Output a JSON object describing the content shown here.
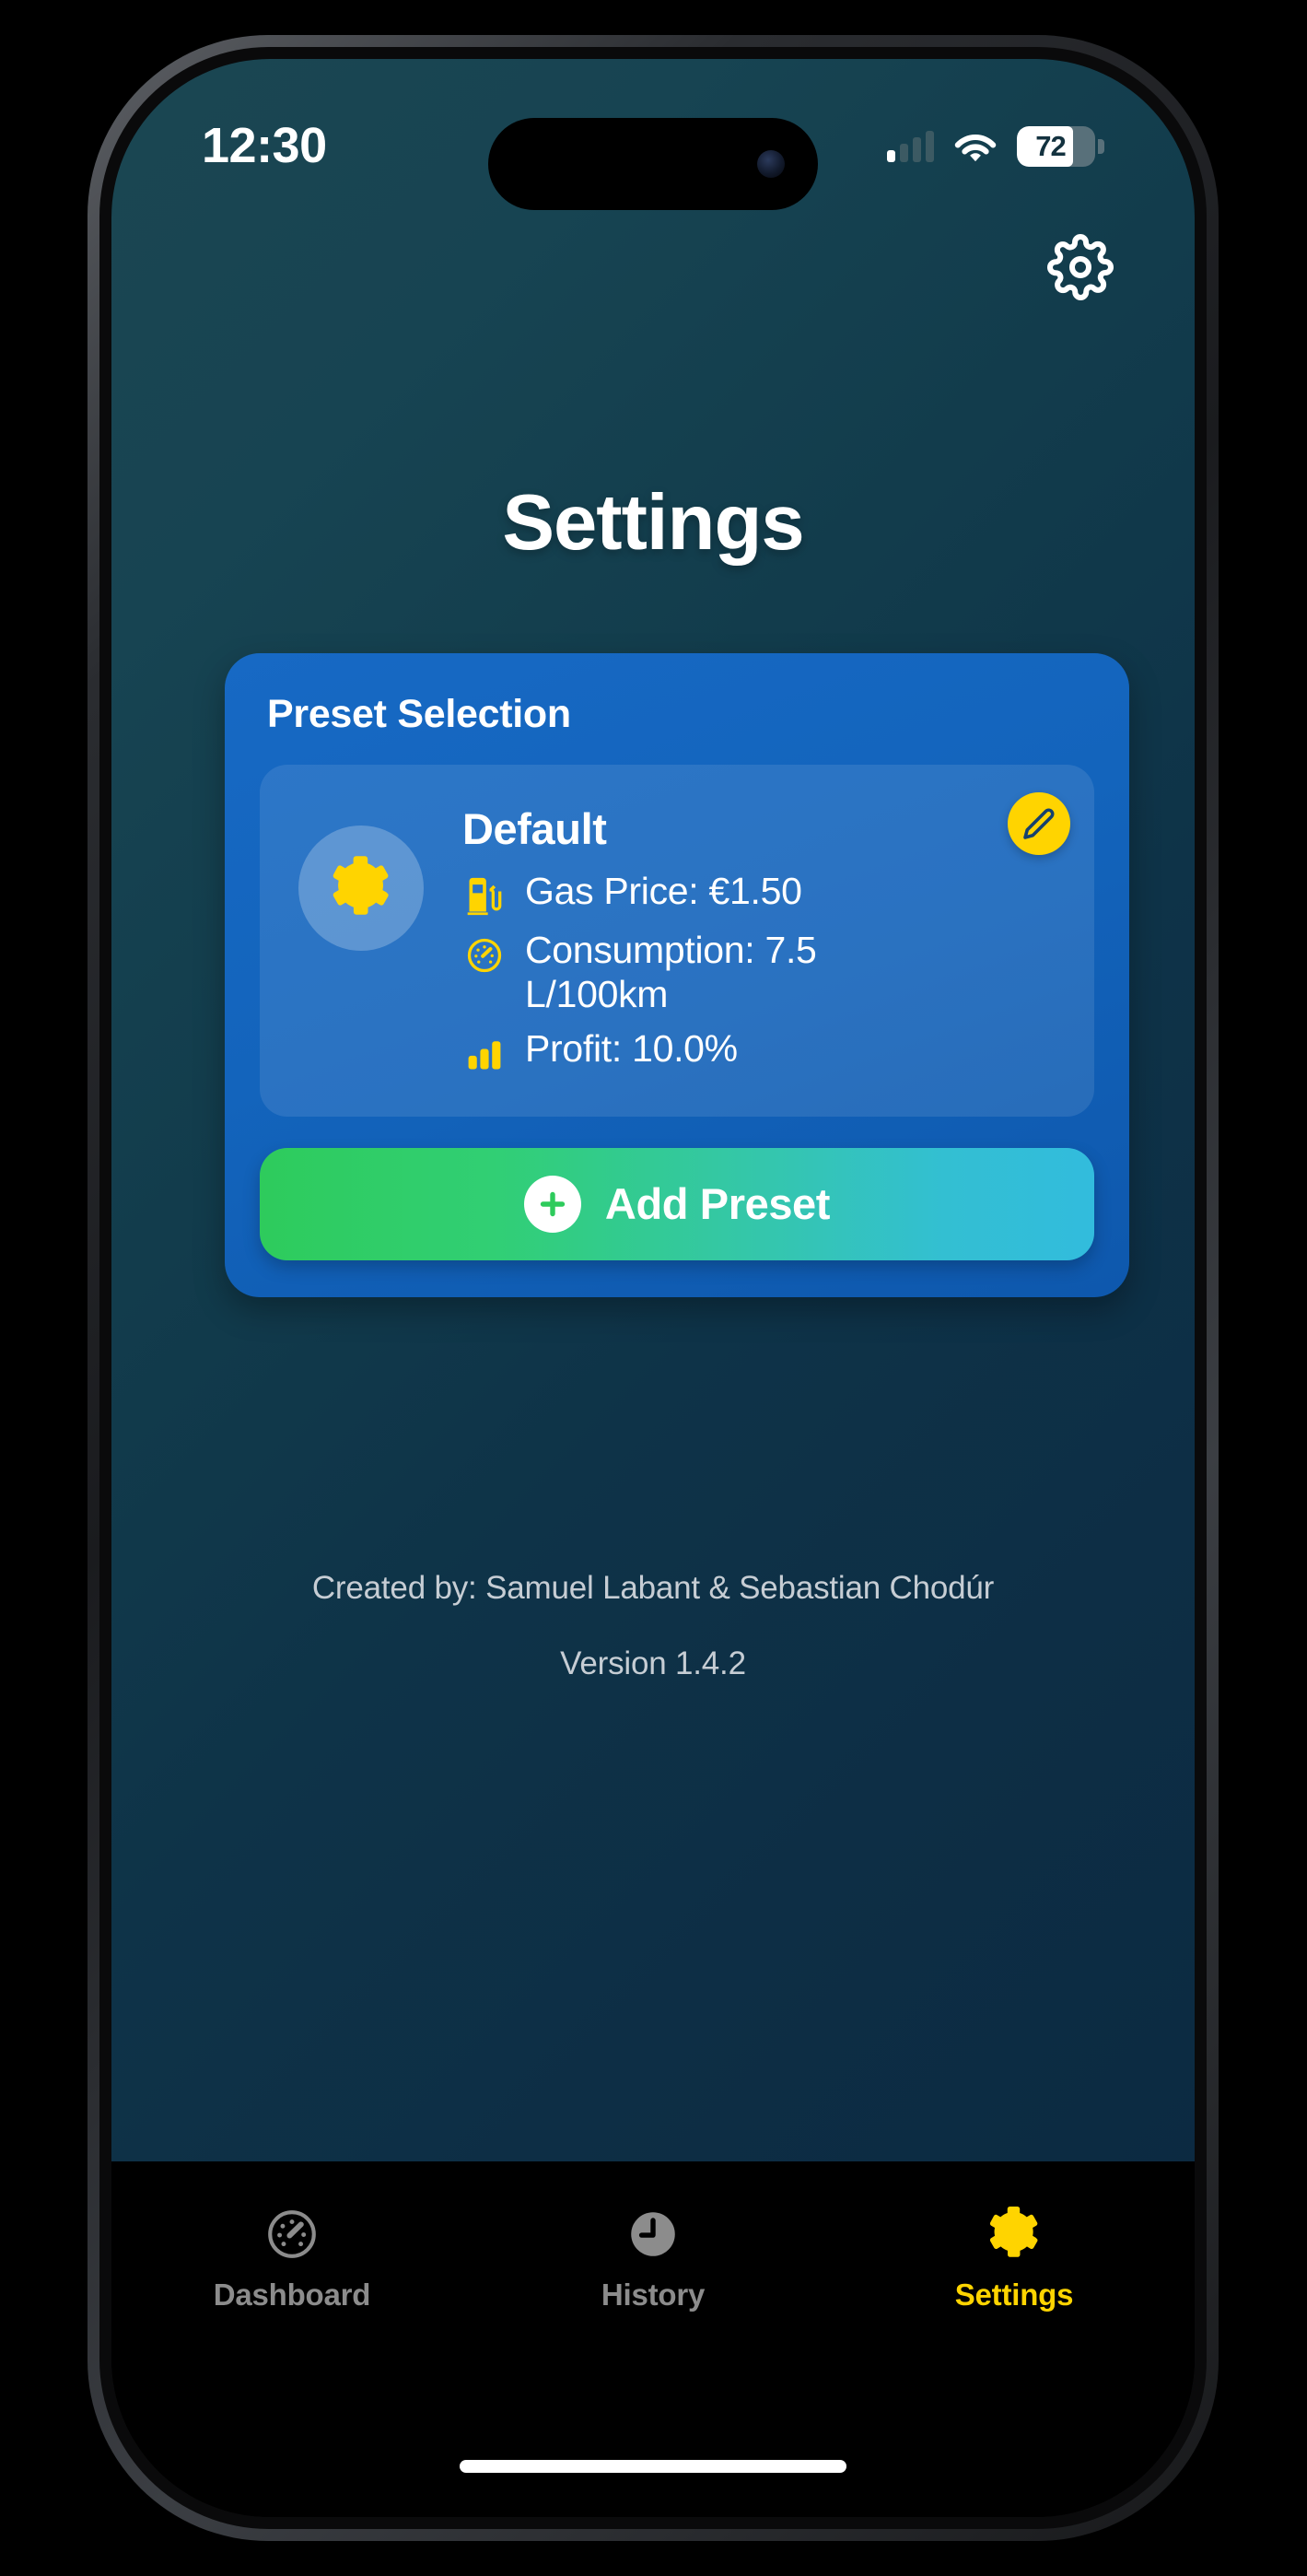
{
  "status_bar": {
    "time": "12:30",
    "battery_level": "72",
    "icons": {
      "signal": "signal-bars-icon",
      "wifi": "wifi-icon",
      "battery": "battery-icon"
    }
  },
  "header": {
    "settings_icon": "gear-icon"
  },
  "page": {
    "title": "Settings"
  },
  "preset_card": {
    "title": "Preset Selection",
    "preset": {
      "avatar_icon": "gear-icon",
      "name": "Default",
      "rows": [
        {
          "icon": "fuel-pump-icon",
          "text": "Gas Price: €1.50"
        },
        {
          "icon": "speedometer-icon",
          "text": "Consumption: 7.5 L/100km"
        },
        {
          "icon": "bar-chart-icon",
          "text": "Profit: 10.0%"
        }
      ],
      "edit_icon": "pencil-icon"
    },
    "add_button": {
      "icon": "plus-circle-icon",
      "label": "Add Preset"
    }
  },
  "footer": {
    "credits": "Created by: Samuel Labant & Sebastian Chodúr",
    "version": "Version 1.4.2"
  },
  "tab_bar": {
    "tabs": [
      {
        "label": "Dashboard",
        "icon": "speedometer-icon",
        "active": false
      },
      {
        "label": "History",
        "icon": "clock-icon",
        "active": false
      },
      {
        "label": "Settings",
        "icon": "gear-icon",
        "active": true
      }
    ]
  },
  "colors": {
    "accent_yellow": "#FFD400",
    "card_blue": "#1364BC",
    "add_button_start": "#2ECB5C",
    "add_button_end": "#32BCDD",
    "bg_top": "#1B4652",
    "bg_bottom": "#0C2A41",
    "tab_inactive": "#8C8C8C"
  }
}
